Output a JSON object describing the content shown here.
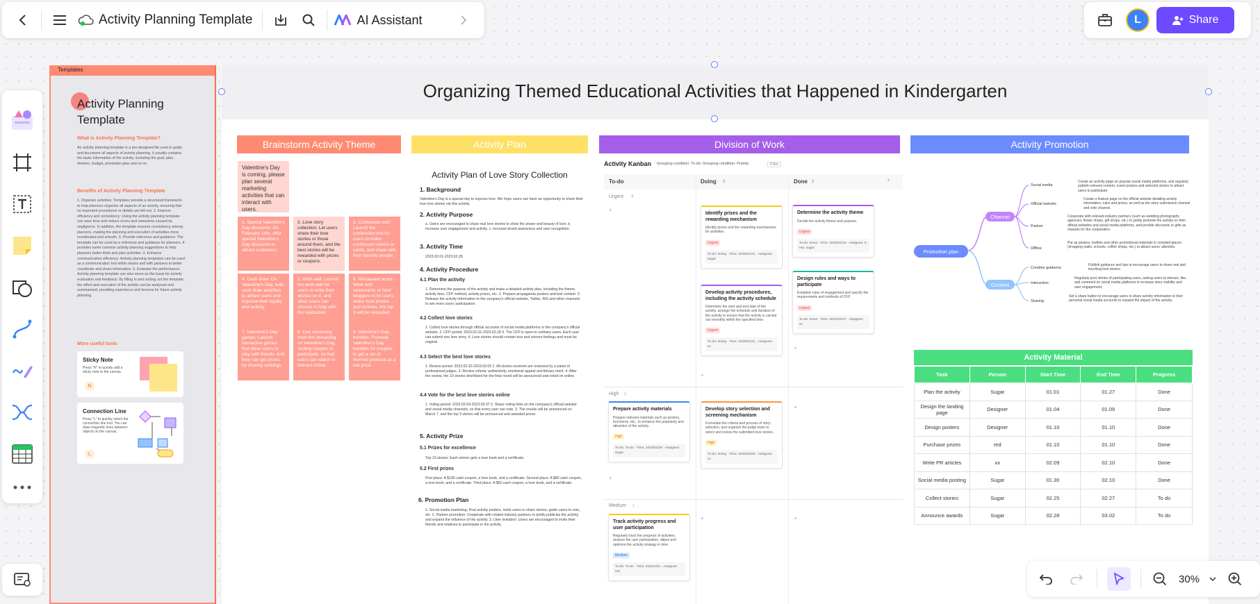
{
  "topbar": {
    "doc_title": "Activity Planning Template",
    "ai_assistant_label": "AI Assistant"
  },
  "rightbar": {
    "avatar_initial": "L",
    "share_label": "Share"
  },
  "zoom": {
    "level": "30%"
  },
  "templates_panel": {
    "header": "Templates",
    "title": "Activity Planning Template",
    "what_heading": "What is Activity Planning Template?",
    "what_text": "An activity planning template is a pre-designed file used to guide and document all aspects of activity planning. It usually contains the basic information of the activity, including the goal, plan, timeline, budget, promotion plan and so on.",
    "benefits_heading": "Benefits of Activity Planning Template",
    "benefits_text": "1. Organize activities: Templates provide a structured framework to help planners organize all aspects of an activity, ensuring that no important procedures or details are left out. 2. Improve efficiency and consistency: Using the activity planning template can save time and reduce errors and omissions caused by negligence. In addition, the template ensures consistency among planners, making the planning and execution of activities more coordinated and smooth. 3. Provide reference and guidance: The template can be used as a reference and guidance for planners. It provides some common activity planning suggestions to help planners better think and plan activities. 4. Enhance communication efficiency: Activity planning templates can be used as a communication tool within teams and with partners to better coordinate and share information. 5. Evaluate the performance: Activity planning template can also serve as the basis for activity evaluation and feedback. By filling in and sorting out the template, the effect and execution of the activity can be analyzed and summarized, providing experience and lessons for future activity planning.",
    "more_tools_heading": "More useful tools",
    "sticky": {
      "title": "Sticky Note",
      "desc": "Press \"N\" to quickly add a sticky note to the canvas.",
      "key": "N"
    },
    "connection": {
      "title": "Connection Line",
      "desc": "Press \"L\" to quickly select the connection line tool. You can draw magnetic lines between objects on the canvas.",
      "key": "L"
    }
  },
  "board": {
    "title": "Organizing Themed Educational Activities that Happened in Kindergarten",
    "columns": [
      {
        "label": "Brainstorm Activity Theme",
        "color": "#ff8a72"
      },
      {
        "label": "Activity Plan",
        "color": "#ffe066"
      },
      {
        "label": "Division of Work",
        "color": "#a55eea"
      },
      {
        "label": "Activity Promotion",
        "color": "#6b8cff"
      }
    ]
  },
  "brainstorm": {
    "intro": "Valentine's Day is coming, please plan several marketing activities that can interact with users.",
    "notes": [
      "1. Special Valentine's Day discounts: On February 14th, offer special Valentine's Day discounts to attract customers.",
      "2. Love story collection: Let users share their love stories or those around them, and the best stories will be rewarded with prizes or coupons.",
      "3. Confession tool: Launch the confession tool for users to make confession videos or cards, and share with their favorite people.",
      "4. Cash draw: On Valentine's Day, hold cash draw activities to attract users and improve their loyalty and activity.",
      "5. Wish wall: Launch the wish wall for users to write their wishes on it, and other users can choose to help with the realization.",
      "6. Restaurant scout: Work with restaurants or food bloggers to let users share food photos and reviews, the top 3 will be rewarded.",
      "7. Valentine's Day games: Launch interactive games that allow users to play with friends. And they can get prizes by sharing rankings.",
      "8. Live streaming: Hold live streaming on Valentine's Day, inviting couples to participate, so that users can watch or interact online.",
      "9. Valentine's Day bundles: Promote Valentine's Day bundles for couples to get a set of themed products at a low price."
    ]
  },
  "plan": {
    "title": "Activity Plan of Love Story Collection",
    "s1": "1. Background",
    "s1_text": "Valentine's Day is a special day to express love. We hope users can have an opportunity to share their true love stories via this activity.",
    "s2": "2. Activity Purpose",
    "s2_text": "a. Users are encouraged to share real love stories to show the power and beauty of love. b. Increase user engagement and activity. c. Increase brand awareness and user recognition.",
    "s3": "3. Activity Time",
    "s3_text": "2023.02.01-2023.02.28",
    "s4": "4. Activity Procedure",
    "s41": "4.1 Plan the activity",
    "s41_text": "1. Determine the purpose of the activity and make a detailed activity plan, including the theme, activity time, CFP method, activity prizes, etc. 2. Prepare propaganda posters and text content. 3. Release the activity information to the company's official website, Twitter, INS and other channels to win more users' participation.",
    "s42": "4.2 Collect love stories",
    "s42_text": "1. Collect love stories through official accounts of social media platforms or the company's official website. 2. CFP period: 2023.02.01-2023.02.28 3. The CFP is open to ordinary users. Each user can submit one love story. 4. Love stories should contain true and sincere feelings and must be original.",
    "s43": "4.3 Select the best love stories",
    "s43_text": "1. Review period: 2023.02.20-2023.03.03 2. All stories received are reviewed by a panel of professional judges. 3. Review criteria: authenticity, emotional appeal and literary merit. 4. After the review, the 10 stories shortlisted for the final round will be announced and voted on online.",
    "s44": "4.4 Vote for the best love stories online",
    "s44_text": "1. Voting period: 2023.03.03-2023.03.07 2. Share voting links on the company's official website and social media channels, so that every user can vote. 3. The results will be announced on March 7, and the top 3 stories will be announced and awarded prizes.",
    "s5": "5. Activity Prize",
    "s51": "5.1 Prizes for excellence",
    "s51_text": "Top 10 stories: Each winner gets a love book and a certificate.",
    "s52": "5.2 First prizes",
    "s52_text": "First place: A $100 cash coupon, a love book, and a certificate. Second place: A $80 cash coupon, a love book, and a certificate. Third place: A $50 cash coupon, a love book, and a certificate.",
    "s6": "6. Promotion Plan",
    "s6_text": "1. Social media marketing: Post activity posters, invite users to share stories, guide users to vote, etc. 2. Partner promotion: Cooperate with related industry partners to jointly publicize the activity and expand the influence of the activity. 3. User invitation: Users are encouraged to invite their friends and relatives to participate in the activity."
  },
  "kanban": {
    "title": "Activity Kanban",
    "grouping": "Grouping condition: To-do; Grouping condition: Priority",
    "filter": "Filter",
    "cols": [
      "To-do",
      "Doing",
      "Done"
    ],
    "col_counts": [
      "",
      "3",
      "2"
    ],
    "lanes": [
      {
        "name": "Urgent",
        "count": "4"
      },
      {
        "name": "High",
        "count": "2"
      },
      {
        "name": "Medium",
        "count": "1"
      }
    ],
    "cards": [
      {
        "title": "Identify prizes and the rewarding mechanism",
        "desc": "Identify prizes and the rewarding mechanisms for activities.",
        "badge": "Urgent",
        "meta": "To-do: Doing · Time: 2023/01/21 · Assignee: sugar"
      },
      {
        "title": "Determine the activity theme",
        "desc": "Decide the activity theme and purpose.",
        "badge": "Urgent",
        "meta": "To-do: Done · Time: 2023/01/15 · Assignee: tt, red, sugar"
      },
      {
        "title": "Develop activity procedures, including the activity schedule",
        "desc": "Determine the start and end date of the activity, arrange the schedule and duration of the activity to ensure that the activity is carried out smoothly within the specified time.",
        "badge": "Urgent",
        "meta": "To-do: Doing · Time: 2023/01/21 · Assignee: xx"
      },
      {
        "title": "Design rules and ways to participate",
        "desc": "Establish rules of engagement and specify the requirements and methods of CFP.",
        "badge": "Urgent",
        "meta": "To-do: Done · Time: 2023/01/27 · Assignee: xx"
      },
      {
        "title": "Prepare activity materials",
        "desc": "Prepare relevant materials such as posters, brochures, etc., to enhance the popularity and attraction of the activity.",
        "badge": "High",
        "meta": "To-do: To-do · Time: 2023/01/28 · Assignee: sugar"
      },
      {
        "title": "Develop story selection and screening mechanism",
        "desc": "Formulate the criteria and process of story selection, and organize the judge team to select and review the submitted love stories.",
        "badge": "High",
        "meta": "To-do: Doing · Time: 2023/02/20 · Assignee: xx"
      },
      {
        "title": "Track activity progress and user participation",
        "desc": "Regularly track the progress of activities, analyze the user participation, adjust and optimize the activity strategy in time.",
        "badge": "Medium",
        "meta": "To-do: To-do · Time: 2023/1/31 · Assignee: red"
      }
    ]
  },
  "promotion": {
    "root": "Promotion plan",
    "channel": "Channel",
    "content": "Content",
    "items": [
      {
        "name": "Social media",
        "desc": "Create an activity page on popular social media platforms, and regularly publish relevant content, event posters and selected stories to attract users to participate."
      },
      {
        "name": "Official website",
        "desc": "Create a feature page on the official website detailing activity information, rules and prizes, as well as the story submission channel and vote channel."
      },
      {
        "name": "Partner",
        "desc": "Cooperate with relevant industry partners (such as wedding photography agencies, flower shops, gift shops, etc.) to jointly promote the activity on their official websites and social media platforms, and provide discounts or gifts as rewards for the cooperation."
      },
      {
        "name": "Offline",
        "desc": "Put up posters, leaflets and other promotional materials in crowded places (shopping malls, schools, coffee shops, etc.) to attract users' attention."
      },
      {
        "name": "Creative guidance",
        "desc": "Publish guidance and tips to encourage users to share real and touching love stories."
      },
      {
        "name": "Interaction",
        "desc": "Regularly post stories of participating users, asking users to interact, like, and comment on social media platforms to increase story visibility and user engagement."
      },
      {
        "name": "Sharing",
        "desc": "Set a share button to encourage users to share activity information to their personal social media accounts to expand the impact of the activity."
      }
    ]
  },
  "material": {
    "title": "Activity Material",
    "headers": [
      "Task",
      "Person",
      "Start Time",
      "End Time",
      "Progress"
    ],
    "rows": [
      [
        "Plan the activity",
        "Sugar",
        "01.01",
        "01.27",
        "Done"
      ],
      [
        "Design the landing page",
        "Designer",
        "01.04",
        "01.09",
        "Done"
      ],
      [
        "Design posters",
        "Designer",
        "01.10",
        "01.10",
        "Done"
      ],
      [
        "Purchase prizes",
        "red",
        "01.10",
        "01.10",
        "Done"
      ],
      [
        "Write PR articles",
        "xx",
        "02.09",
        "02.10",
        "Done"
      ],
      [
        "Social media posting",
        "Sugar",
        "01.30",
        "02.10",
        "Done"
      ],
      [
        "Collect stories",
        "Sugar",
        "02.25",
        "02.27",
        "To do"
      ],
      [
        "Announce awards",
        "Sugar",
        "02.28",
        "03.02",
        "To do"
      ]
    ]
  }
}
